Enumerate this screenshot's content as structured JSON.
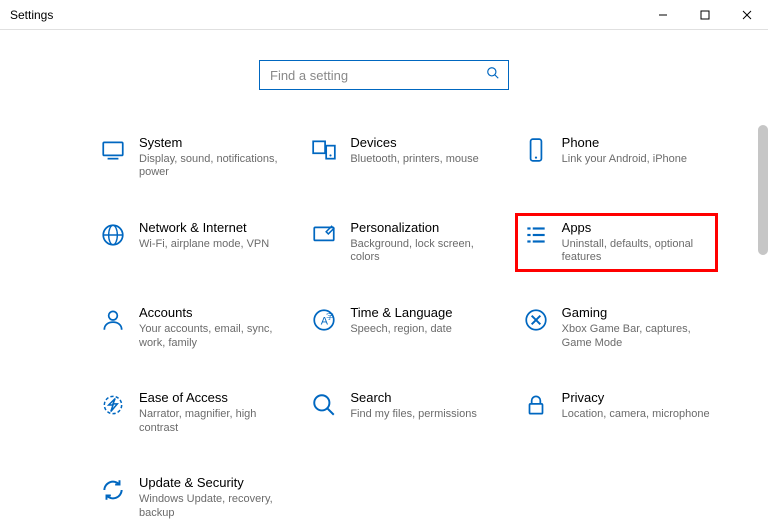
{
  "window": {
    "title": "Settings"
  },
  "search": {
    "placeholder": "Find a setting"
  },
  "tiles": [
    {
      "title": "System",
      "desc": "Display, sound, notifications, power",
      "icon": "system-icon",
      "highlighted": false
    },
    {
      "title": "Devices",
      "desc": "Bluetooth, printers, mouse",
      "icon": "devices-icon",
      "highlighted": false
    },
    {
      "title": "Phone",
      "desc": "Link your Android, iPhone",
      "icon": "phone-icon",
      "highlighted": false
    },
    {
      "title": "Network & Internet",
      "desc": "Wi-Fi, airplane mode, VPN",
      "icon": "network-icon",
      "highlighted": false
    },
    {
      "title": "Personalization",
      "desc": "Background, lock screen, colors",
      "icon": "personalization-icon",
      "highlighted": false
    },
    {
      "title": "Apps",
      "desc": "Uninstall, defaults, optional features",
      "icon": "apps-icon",
      "highlighted": true
    },
    {
      "title": "Accounts",
      "desc": "Your accounts, email, sync, work, family",
      "icon": "accounts-icon",
      "highlighted": false
    },
    {
      "title": "Time & Language",
      "desc": "Speech, region, date",
      "icon": "time-language-icon",
      "highlighted": false
    },
    {
      "title": "Gaming",
      "desc": "Xbox Game Bar, captures, Game Mode",
      "icon": "gaming-icon",
      "highlighted": false
    },
    {
      "title": "Ease of Access",
      "desc": "Narrator, magnifier, high contrast",
      "icon": "ease-of-access-icon",
      "highlighted": false
    },
    {
      "title": "Search",
      "desc": "Find my files, permissions",
      "icon": "search-icon",
      "highlighted": false
    },
    {
      "title": "Privacy",
      "desc": "Location, camera, microphone",
      "icon": "privacy-icon",
      "highlighted": false
    },
    {
      "title": "Update & Security",
      "desc": "Windows Update, recovery, backup",
      "icon": "update-security-icon",
      "highlighted": false
    }
  ]
}
